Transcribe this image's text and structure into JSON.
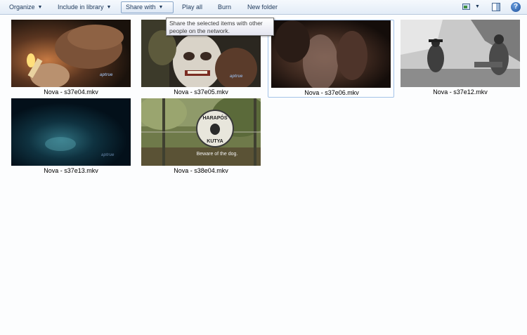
{
  "toolbar": {
    "organize": "Organize",
    "include_in_library": "Include in library",
    "share_with": "Share with",
    "play_all": "Play all",
    "burn": "Burn",
    "new_folder": "New folder",
    "caret": "▼",
    "views_icon": "change-view-icon",
    "preview_pane_icon": "preview-pane-icon",
    "help_icon": "help-icon",
    "help_glyph": "?"
  },
  "tooltip": {
    "text": "Share the selected items with other people on the network."
  },
  "files": [
    {
      "name": "Nova - s37e04.mkv",
      "thumb": "hand-lighter",
      "watermark": "aptrue"
    },
    {
      "name": "Nova - s37e05.mkv",
      "thumb": "mask",
      "watermark": "aptrue"
    },
    {
      "name": "Nova - s37e06.mkv",
      "thumb": "dark-figure",
      "watermark": "",
      "selected": true
    },
    {
      "name": "Nova - s37e12.mkv",
      "thumb": "bw-explorers",
      "watermark": ""
    },
    {
      "name": "Nova - s37e13.mkv",
      "thumb": "underwater",
      "watermark": "aptrue"
    },
    {
      "name": "Nova - s38e04.mkv",
      "thumb": "dog-sign",
      "watermark": "",
      "sign_top": "HARAPÓS",
      "sign_bottom": "KUTYA",
      "subtitle": "Beware of the dog."
    }
  ],
  "colors": {
    "toolbar_text": "#1e395b",
    "selection_border": "#a3c3e8"
  }
}
